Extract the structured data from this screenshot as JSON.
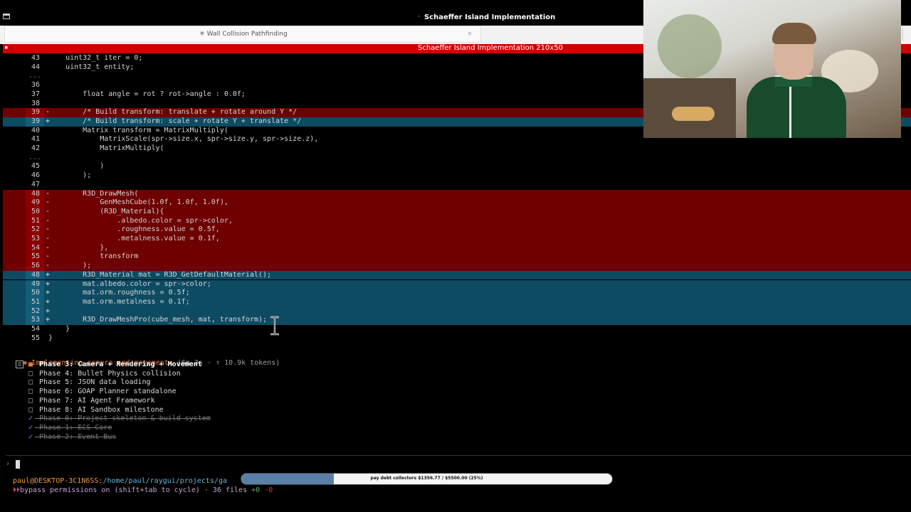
{
  "window": {
    "title": "Schaeffer Island Implementation",
    "dot": "·"
  },
  "tab": {
    "label": "✳ Wall Collision Pathfinding",
    "close": "×"
  },
  "terminal": {
    "title": "Schaeffer Island Implementation 210x50"
  },
  "diff_lines": [
    {
      "num": "43",
      "mark": " ",
      "type": "ctx",
      "code": "    uint32_t iter = 0;"
    },
    {
      "num": "44",
      "mark": " ",
      "type": "ctx",
      "code": "    uint32_t entity;"
    },
    {
      "num": "...",
      "mark": " ",
      "type": "dots",
      "code": ""
    },
    {
      "num": "36",
      "mark": " ",
      "type": "ctx",
      "code": ""
    },
    {
      "num": "37",
      "mark": " ",
      "type": "ctx",
      "code": "        float angle = rot ? rot->angle : 0.0f;"
    },
    {
      "num": "38",
      "mark": " ",
      "type": "ctx",
      "code": ""
    },
    {
      "num": "39",
      "mark": "-",
      "type": "del",
      "code": "        /* Build transform: translate + rotate around Y */"
    },
    {
      "num": "39",
      "mark": "+",
      "type": "add",
      "code": "        /* Build transform: scale + rotate Y + translate */"
    },
    {
      "num": "40",
      "mark": " ",
      "type": "ctx",
      "code": "        Matrix transform = MatrixMultiply("
    },
    {
      "num": "41",
      "mark": " ",
      "type": "ctx",
      "code": "            MatrixScale(spr->size.x, spr->size.y, spr->size.z),"
    },
    {
      "num": "42",
      "mark": " ",
      "type": "ctx",
      "code": "            MatrixMultiply("
    },
    {
      "num": "...",
      "mark": " ",
      "type": "dots",
      "code": ""
    },
    {
      "num": "45",
      "mark": " ",
      "type": "ctx",
      "code": "            )"
    },
    {
      "num": "46",
      "mark": " ",
      "type": "ctx",
      "code": "        );"
    },
    {
      "num": "47",
      "mark": " ",
      "type": "ctx",
      "code": ""
    },
    {
      "num": "48",
      "mark": "-",
      "type": "del",
      "code": "        R3D_DrawMesh("
    },
    {
      "num": "49",
      "mark": "-",
      "type": "del",
      "code": "            GenMeshCube(1.0f, 1.0f, 1.0f),"
    },
    {
      "num": "50",
      "mark": "-",
      "type": "del",
      "code": "            (R3D_Material){"
    },
    {
      "num": "51",
      "mark": "-",
      "type": "del",
      "code": "                .albedo.color = spr->color,"
    },
    {
      "num": "52",
      "mark": "-",
      "type": "del",
      "code": "                .roughness.value = 0.5f,"
    },
    {
      "num": "53",
      "mark": "-",
      "type": "del",
      "code": "                .metalness.value = 0.1f,"
    },
    {
      "num": "54",
      "mark": "-",
      "type": "del",
      "code": "            },"
    },
    {
      "num": "55",
      "mark": "-",
      "type": "del",
      "code": "            transform"
    },
    {
      "num": "56",
      "mark": "-",
      "type": "del",
      "code": "        );"
    },
    {
      "num": "48",
      "mark": "+",
      "type": "add",
      "code": "        R3D_Material mat = R3D_GetDefaultMaterial();"
    },
    {
      "num": "49",
      "mark": "+",
      "type": "add",
      "code": "        mat.albedo.color = spr->color;"
    },
    {
      "num": "50",
      "mark": "+",
      "type": "add",
      "code": "        mat.orm.roughness = 0.5f;"
    },
    {
      "num": "51",
      "mark": "+",
      "type": "add",
      "code": "        mat.orm.metalness = 0.1f;"
    },
    {
      "num": "52",
      "mark": "+",
      "type": "add",
      "code": ""
    },
    {
      "num": "53",
      "mark": "+",
      "type": "add",
      "code": "        R3D_DrawMeshPro(cube_mesh, mat, transform);"
    },
    {
      "num": "54",
      "mark": " ",
      "type": "ctx",
      "code": "    }"
    },
    {
      "num": "55",
      "mark": " ",
      "type": "ctx",
      "code": "}"
    }
  ],
  "status": {
    "icon": "✱",
    "text": " Implementing camera and movement… ",
    "meta": "(6m 3s · ↑ 10.9k tokens)"
  },
  "tasks": [
    {
      "box": "■",
      "label": "Phase 3: Camera + Rendering + Movement",
      "state": "current"
    },
    {
      "box": "□",
      "label": "Phase 4: Bullet Physics collision",
      "state": "pending"
    },
    {
      "box": "□",
      "label": "Phase 5: JSON data loading",
      "state": "pending"
    },
    {
      "box": "□",
      "label": "Phase 6: GOAP Planner standalone",
      "state": "pending"
    },
    {
      "box": "□",
      "label": "Phase 7: AI Agent Framework",
      "state": "pending"
    },
    {
      "box": "□",
      "label": "Phase 8: AI Sandbox milestone",
      "state": "pending"
    },
    {
      "box": "✓",
      "label": "Phase 0: Project skeleton & build system",
      "state": "done"
    },
    {
      "box": "✓",
      "label": "Phase 1: ECS Core",
      "state": "done"
    },
    {
      "box": "✓",
      "label": "Phase 2: Event Bus",
      "state": "done"
    }
  ],
  "prompt": {
    "glyph": "›"
  },
  "footer": {
    "user": "paul@DESKTOP-3C1N6SS:",
    "path": "/home/paul/raygui/projects/ga",
    "bypass_icon": "⏵⏵",
    "bypass_text": "bypass permissions on",
    "hint": " (shift+tab to cycle) · 36 files ",
    "plus": "+0",
    "minus": " -0"
  },
  "donation": {
    "label": "pay debt collectors $1356.77 / $5500.00 (25%)",
    "progress": 0.25,
    "color": "#5a7fa8"
  },
  "colors": {
    "del_bg": "#6e0000",
    "add_bg": "#0d4b63",
    "header_red": "#d10000",
    "accent": "#e07a3b"
  }
}
